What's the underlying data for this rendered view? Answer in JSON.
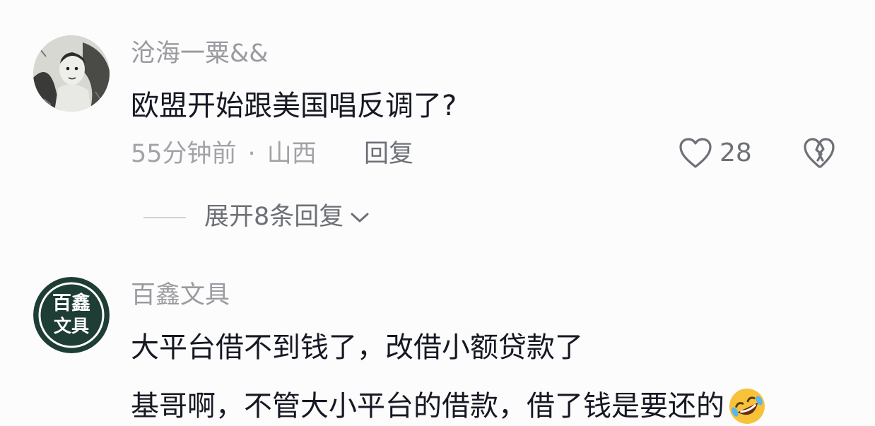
{
  "comments": [
    {
      "username": "沧海一粟&&",
      "avatar_icon": "vintage-photo-avatar-icon",
      "text_lines": [
        "欧盟开始跟美国唱反调了?"
      ],
      "time": "55分钟前",
      "separator": "·",
      "location": "山西",
      "reply_label": "回复",
      "like_icon": "heart-outline-icon",
      "like_count": "28",
      "dislike_icon": "broken-heart-icon",
      "expand_label": "展开8条回复",
      "expand_icon": "chevron-down-icon"
    },
    {
      "username": "百鑫文具",
      "avatar_icon": "text-logo-avatar-icon",
      "avatar_text_top": "百鑫",
      "avatar_text_bottom": "文具",
      "avatar_color": "#1e3d35",
      "text_lines": [
        "大平台借不到钱了，改借小额贷款了",
        "基哥啊，不管大小平台的借款，借了钱是要还的"
      ],
      "emoji_icon": "rolling-laughing-emoji-icon"
    }
  ]
}
